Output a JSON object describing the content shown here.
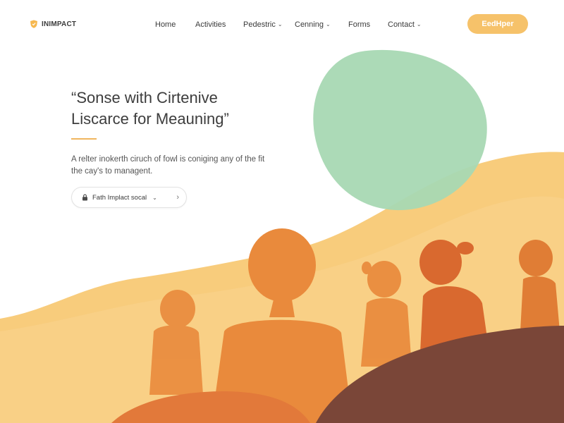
{
  "brand": {
    "name": "INIMPACT",
    "icon": "shield-icon",
    "accent": "#f6c26a"
  },
  "nav": {
    "items": [
      {
        "label": "Home",
        "dropdown": false
      },
      {
        "label": "Activities",
        "dropdown": false
      },
      {
        "label": "Pedestric",
        "dropdown": true
      },
      {
        "label": "Cenning",
        "dropdown": true
      },
      {
        "label": "Forms",
        "dropdown": false
      },
      {
        "label": "Contact",
        "dropdown": true
      }
    ],
    "cta_label": "EedHper"
  },
  "hero": {
    "title_line1": "“Sonse with Cirtenive",
    "title_line2": "Liscarce for Meauning”",
    "description": "A relter inokerth ciruch of fowl is coniging any of the fit the cay's to managent.",
    "pill_label": "Fath Implact socal",
    "pill_chevron_icon": "chevron-down-icon",
    "pill_arrow_icon": "chevron-right-icon"
  },
  "colors": {
    "green_blob": "#a8d8b3",
    "yellow_wave": "#f8cc7c",
    "orange_silhouette": "#e98a3c",
    "dark_hill": "#7a4638"
  }
}
